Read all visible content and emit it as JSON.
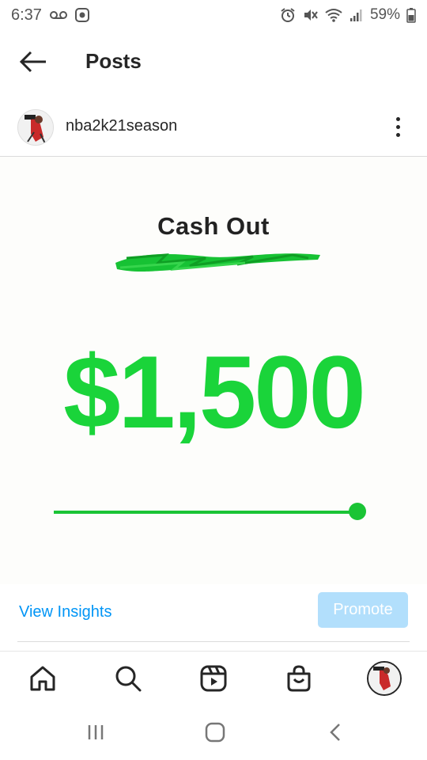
{
  "status_bar": {
    "time": "6:37",
    "battery": "59%",
    "icons": [
      "voicemail-icon",
      "screenshot-icon",
      "alarm-icon",
      "mute-icon",
      "wifi-icon",
      "signal-icon",
      "battery-icon"
    ]
  },
  "header": {
    "title": "Posts",
    "back_icon": "arrow-left-icon"
  },
  "post": {
    "username": "nba2k21season",
    "menu_icon": "more-vertical-icon",
    "image": {
      "heading": "Cash Out",
      "amount": "$1,500",
      "amount_color": "#1ad43a",
      "progress": 1.0
    }
  },
  "actions": {
    "view_insights": "View Insights",
    "promote": "Promote"
  },
  "bottom_nav": {
    "items": [
      "home-icon",
      "search-icon",
      "reels-icon",
      "shop-icon",
      "profile-avatar"
    ]
  },
  "system_nav": {
    "items": [
      "recent-apps-icon",
      "home-button-icon",
      "back-icon"
    ]
  },
  "colors": {
    "accent": "#0095f6",
    "promote_bg": "#b2dffc",
    "cash_green": "#1ad43a"
  }
}
